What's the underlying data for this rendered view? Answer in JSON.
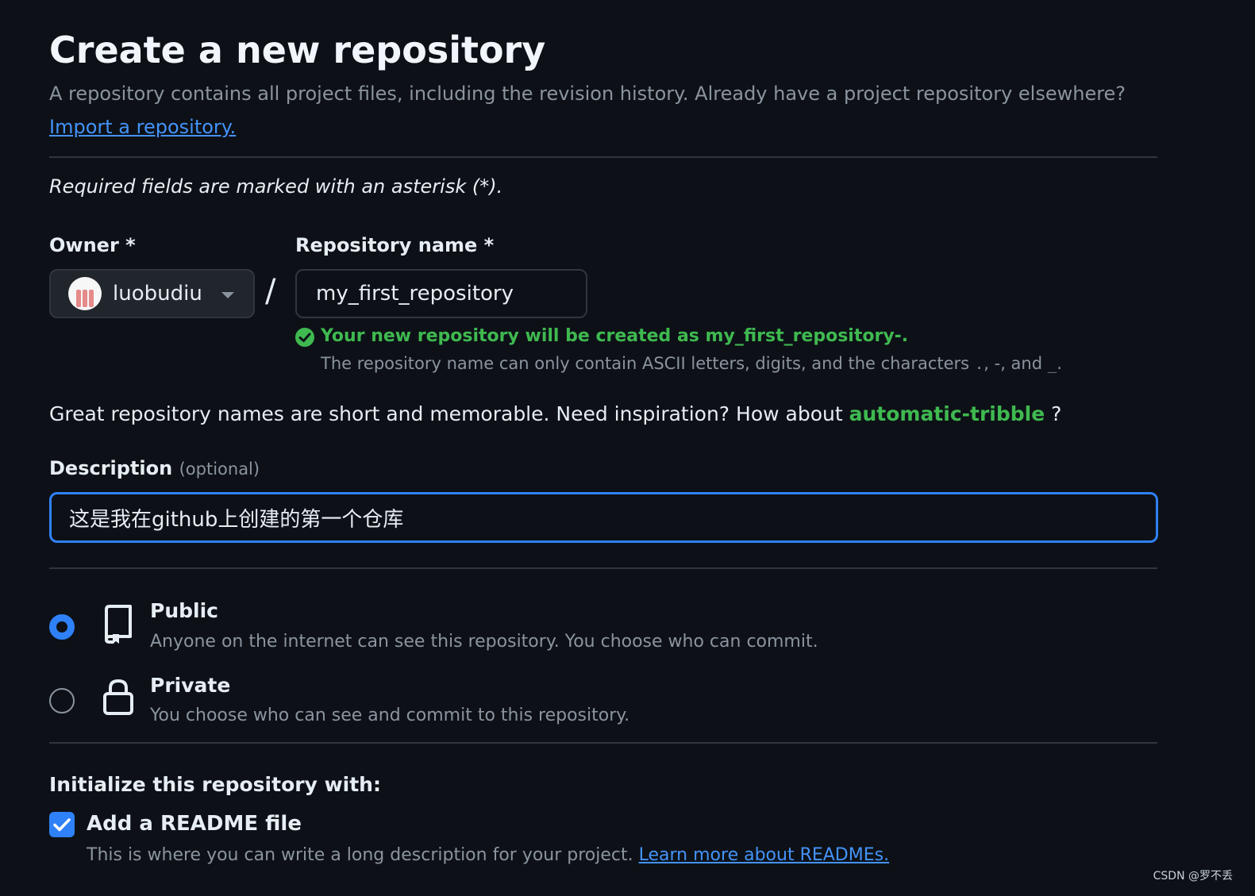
{
  "header": {
    "title": "Create a new repository",
    "subtitle": "A repository contains all project files, including the revision history. Already have a project repository elsewhere?",
    "import_link": "Import a repository."
  },
  "form": {
    "required_note": "Required fields are marked with an asterisk (*).",
    "owner": {
      "label": "Owner *",
      "value": "luobudiu"
    },
    "separator": "/",
    "repo_name": {
      "label": "Repository name *",
      "value": "my_first_repository"
    },
    "validation": {
      "message": "Your new repository will be created as my_first_repository-.",
      "hint_prefix": "The repository name can only contain ASCII letters, digits, and the characters",
      "hint_chars": ".",
      "hint_middle": ", -, and",
      "hint_last": "_",
      "hint_end": "."
    },
    "inspiration": {
      "text": "Great repository names are short and memorable. Need inspiration? How about",
      "suggestion": "automatic-tribble",
      "end": "?"
    },
    "description": {
      "label": "Description",
      "optional": "(optional)",
      "value": "这是我在github上创建的第一个仓库"
    },
    "visibility": [
      {
        "title": "Public",
        "description": "Anyone on the internet can see this repository. You choose who can commit.",
        "selected": true,
        "icon": "repo-icon"
      },
      {
        "title": "Private",
        "description": "You choose who can see and commit to this repository.",
        "selected": false,
        "icon": "lock-icon"
      }
    ],
    "initialize": {
      "title": "Initialize this repository with:",
      "readme_label": "Add a README file",
      "readme_checked": true,
      "readme_desc": "This is where you can write a long description for your project.",
      "readme_link": "Learn more about READMEs."
    }
  },
  "watermark": "CSDN @罗不丢",
  "colors": {
    "background": "#0d1117",
    "accent": "#2f81f7",
    "success": "#3fb950",
    "link": "#4493f8",
    "muted": "#8b949e"
  }
}
